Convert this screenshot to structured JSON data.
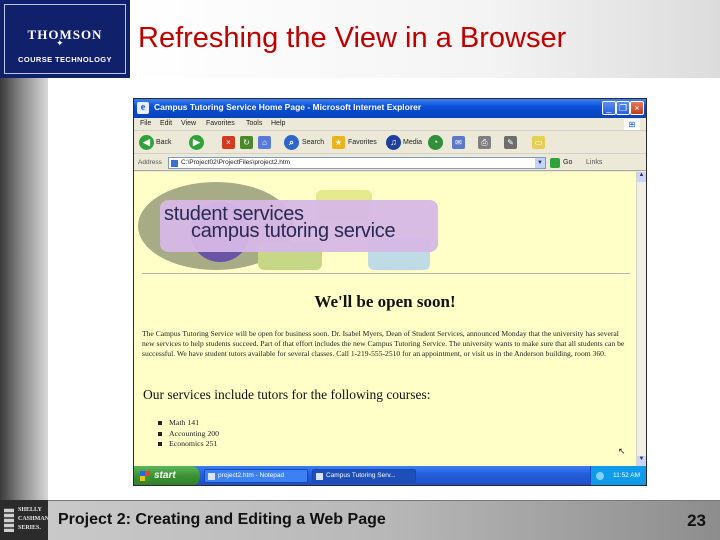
{
  "slide": {
    "logo_line1": "THOMSON",
    "logo_line2": "COURSE TECHNOLOGY",
    "title": "Refreshing the View in a Browser",
    "footer": "Project 2: Creating and Editing a Web Page",
    "page_number": "23",
    "series_logo": [
      "SHELLY",
      "CASHMAN",
      "SERIES."
    ]
  },
  "browser": {
    "window_title": "Campus Tutoring Service Home Page - Microsoft Internet Explorer",
    "menu": [
      "File",
      "Edit",
      "View",
      "Favorites",
      "Tools",
      "Help"
    ],
    "toolbar": {
      "back": "Back",
      "search": "Search",
      "favorites": "Favorites",
      "media": "Media"
    },
    "address_label": "Address",
    "address": "C:\\Project02\\ProjectFiles\\project2.htm",
    "go": "Go",
    "links": "Links"
  },
  "page": {
    "banner_line1": "student services",
    "banner_line2": "campus tutoring service",
    "heading": "We'll be open soon!",
    "paragraph": "The Campus Tutoring Service will be open for business soon. Dr. Isabel Myers, Dean of Student Services, announced Monday that the university has several new services to help students succeed. Part of that effort includes the new Campus Tutoring Service. The university wants to make sure that all students can be successful. We have student tutors available for several classes. Call 1-219-555-2510 for an appointment, or visit us in the Anderson building, room 360.",
    "subheading": "Our services include tutors for the following courses:",
    "courses": [
      "Math 141",
      "Accounting 200",
      "Economics 251"
    ]
  },
  "taskbar": {
    "start": "start",
    "tasks": [
      "project2.htm - Notepad",
      "Campus Tutoring Serv..."
    ],
    "clock": "11:52 AM"
  },
  "colors": {
    "title_red": "#c00000",
    "logo_navy": "#10206a",
    "page_background": "#ffffc8",
    "xp_blue": "#0a4fd6"
  }
}
